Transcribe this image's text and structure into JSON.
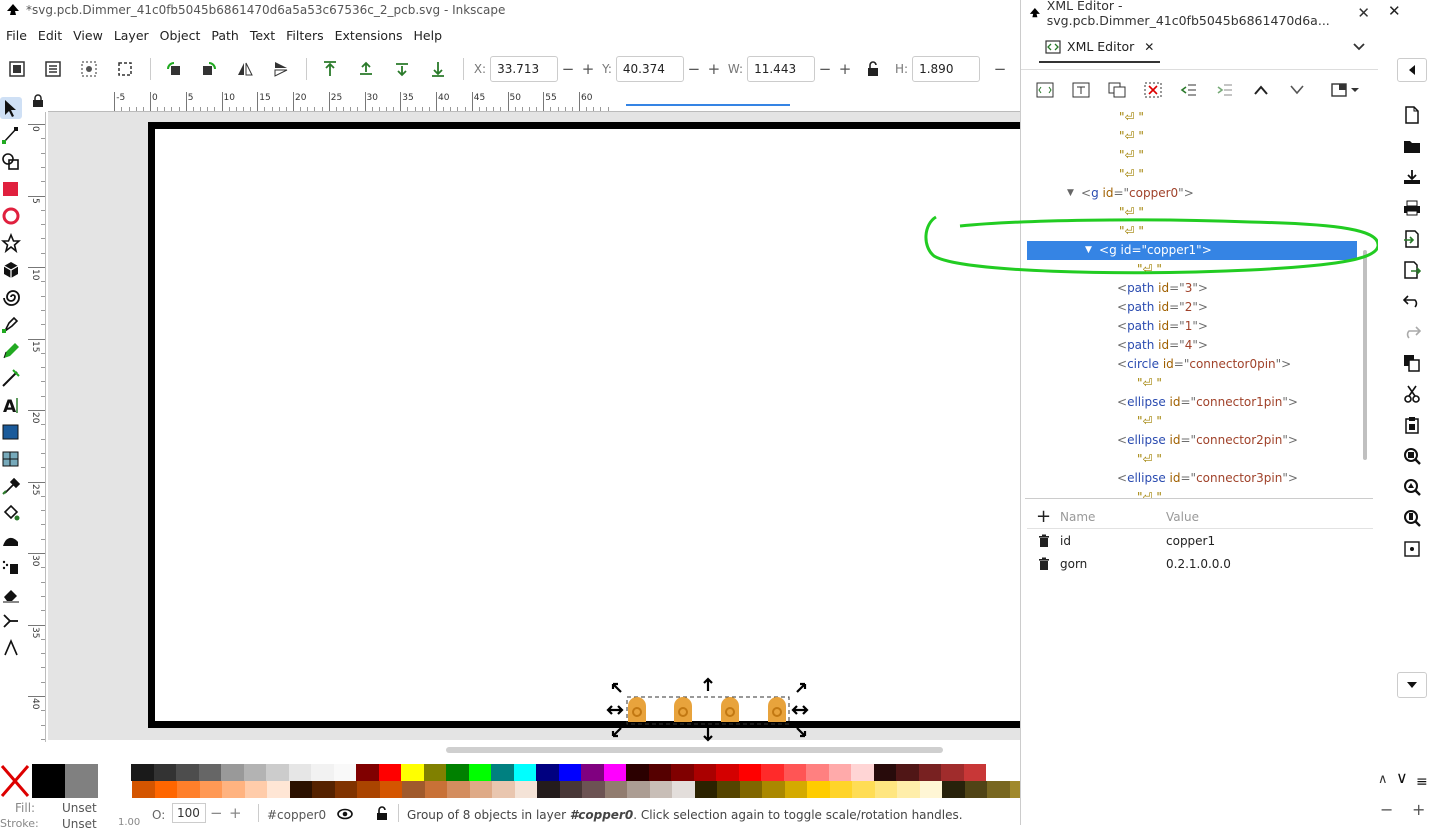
{
  "app": {
    "title": "*svg.pcb.Dimmer_41c0fb5045b6861470d6a5a53c67536c_2_pcb.svg - Inkscape",
    "close_glyph": "✕"
  },
  "menu": [
    "File",
    "Edit",
    "View",
    "Layer",
    "Object",
    "Path",
    "Text",
    "Filters",
    "Extensions",
    "Help"
  ],
  "toolbar": {
    "x_label": "X:",
    "x_value": "33.713",
    "y_label": "Y:",
    "y_value": "40.374",
    "w_label": "W:",
    "w_value": "11.443",
    "h_label": "H:",
    "h_value": "1.890"
  },
  "ruler": {
    "h_ticks": [
      "-5",
      "0",
      "5",
      "10",
      "15",
      "20",
      "25",
      "30",
      "35",
      "40",
      "45",
      "50",
      "55",
      "60"
    ],
    "v_ticks": [
      "0",
      "5",
      "10",
      "15",
      "20",
      "25",
      "30",
      "35",
      "40"
    ]
  },
  "status": {
    "fill_label": "Fill:",
    "fill_value": "Unset",
    "stroke_label": "Stroke:",
    "stroke_value": "Unset",
    "stroke_width": "1.00",
    "opacity_label": "O:",
    "opacity_value": "100",
    "layer": "#copper0",
    "message_prefix": "Group of 8 objects in layer ",
    "message_layer": "#copper0",
    "message_suffix": ". Click selection again to toggle scale/rotation handles."
  },
  "palette_row1": [
    "#000000",
    "#808080",
    "#ffffff",
    "#1a1a1a",
    "#333333",
    "#4d4d4d",
    "#666666",
    "#999999",
    "#b3b3b3",
    "#cccccc",
    "#e6e6e6",
    "#f2f2f2",
    "#f9f9f9",
    "#800000",
    "#ff0000",
    "#ffff00",
    "#808000",
    "#008000",
    "#00ff00",
    "#008080",
    "#00ffff",
    "#000080",
    "#0000ff",
    "#800080",
    "#ff00ff",
    "#2b0000",
    "#550000",
    "#800000",
    "#aa0000",
    "#d40000",
    "#ff0000",
    "#ff2a2a",
    "#ff5555",
    "#ff8080",
    "#ffaaaa",
    "#ffd5d5",
    "#280b0b",
    "#501616",
    "#782121",
    "#a02c2c",
    "#c83737"
  ],
  "palette_row2": [
    "#d45500",
    "#ff6600",
    "#ff7f2a",
    "#ff9955",
    "#ffb380",
    "#ffccaa",
    "#ffe6d5",
    "#2b1100",
    "#552200",
    "#803300",
    "#aa4400",
    "#d45500",
    "#a05a2c",
    "#c87137",
    "#d38d5f",
    "#deaa87",
    "#e9c6af",
    "#f4e3d7",
    "#241c1c",
    "#483737",
    "#6c5353",
    "#917c6f",
    "#ac9d93",
    "#c8beb7",
    "#e3dedb",
    "#2b2200",
    "#554400",
    "#806600",
    "#aa8800",
    "#d4aa00",
    "#ffcc00",
    "#ffd42a",
    "#ffdd55",
    "#ffe680",
    "#ffeeaa",
    "#fff6d5",
    "#28220b",
    "#504416",
    "#786721",
    "#a0892c",
    "#c8ab37"
  ],
  "xml_editor": {
    "title": "XML Editor - svg.pcb.Dimmer_41c0fb5045b6861470d6a...",
    "tab_label": "XML Editor",
    "tree": [
      {
        "type": "text",
        "indent": 1,
        "text": "\"⏎    \""
      },
      {
        "type": "text",
        "indent": 1,
        "text": "\"⏎    \""
      },
      {
        "type": "text",
        "indent": 1,
        "text": "\"⏎    \""
      },
      {
        "type": "text",
        "indent": 1,
        "text": "\"⏎  \""
      },
      {
        "type": "node",
        "indent": 0,
        "expander": "▼",
        "tag": "g",
        "attr": "id",
        "value": "copper0",
        "selected": false
      },
      {
        "type": "text",
        "indent": 1,
        "text": "\"⏎       \""
      },
      {
        "type": "text",
        "indent": 1,
        "text": "\"⏎   \""
      },
      {
        "type": "node",
        "indent": 1,
        "expander": "▼",
        "tag": "g",
        "attr": "id",
        "value": "copper1",
        "selected": true
      },
      {
        "type": "text",
        "indent": 2,
        "text": "\"⏎       \""
      },
      {
        "type": "node",
        "indent": 2,
        "expander": "",
        "tag": "path",
        "attr": "id",
        "value": "3",
        "selected": false
      },
      {
        "type": "node",
        "indent": 2,
        "expander": "",
        "tag": "path",
        "attr": "id",
        "value": "2",
        "selected": false
      },
      {
        "type": "node",
        "indent": 2,
        "expander": "",
        "tag": "path",
        "attr": "id",
        "value": "1",
        "selected": false
      },
      {
        "type": "node",
        "indent": 2,
        "expander": "",
        "tag": "path",
        "attr": "id",
        "value": "4",
        "selected": false
      },
      {
        "type": "node",
        "indent": 2,
        "expander": "",
        "tag": "circle",
        "attr": "id",
        "value": "connector0pin",
        "selected": false
      },
      {
        "type": "text",
        "indent": 2,
        "text": "\"⏎       \""
      },
      {
        "type": "node",
        "indent": 2,
        "expander": "",
        "tag": "ellipse",
        "attr": "id",
        "value": "connector1pin",
        "selected": false
      },
      {
        "type": "text",
        "indent": 2,
        "text": "\"⏎       \""
      },
      {
        "type": "node",
        "indent": 2,
        "expander": "",
        "tag": "ellipse",
        "attr": "id",
        "value": "connector2pin",
        "selected": false
      },
      {
        "type": "text",
        "indent": 2,
        "text": "\"⏎       \""
      },
      {
        "type": "node",
        "indent": 2,
        "expander": "",
        "tag": "ellipse",
        "attr": "id",
        "value": "connector3pin",
        "selected": false
      },
      {
        "type": "text",
        "indent": 2,
        "text": "\"⏎       \""
      }
    ],
    "attr_header": {
      "name": "Name",
      "value": "Value"
    },
    "attributes": [
      {
        "name": "id",
        "value": "copper1"
      },
      {
        "name": "gorn",
        "value": "0.2.1.0.0.0"
      }
    ]
  },
  "colors": {
    "selection": "#3584e4",
    "annotation": "#22cc22",
    "pad": "#e8a33c"
  }
}
